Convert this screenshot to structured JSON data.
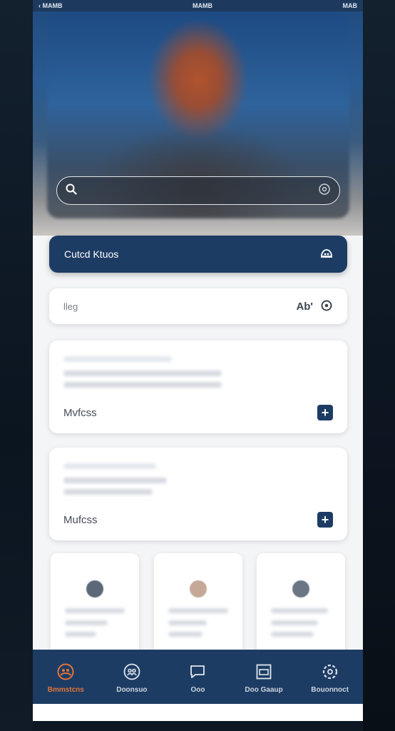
{
  "status_bar": {
    "left": "‹ MAMB",
    "center": "MAMB",
    "right": "MAB"
  },
  "search": {
    "placeholder": "",
    "value": ""
  },
  "action_button": {
    "label": "Cutcd Ktuos",
    "icon": "tools-icon"
  },
  "filter_row": {
    "label": "lleg",
    "right_label": "Ab'",
    "icon": "settings-icon"
  },
  "cards": [
    {
      "label": "Mvfcss",
      "icon": "plus-icon"
    },
    {
      "label": "Mufcss",
      "icon": "plus-icon"
    }
  ],
  "tiles": [
    {
      "dot_color": "#5b6878"
    },
    {
      "dot_color": "#c5a898"
    },
    {
      "dot_color": "#6a7686"
    }
  ],
  "bottom_nav": [
    {
      "label": "Bmmstcns",
      "icon": "home-icon",
      "active": true
    },
    {
      "label": "Doonsuo",
      "icon": "people-icon",
      "active": false
    },
    {
      "label": "Ooo",
      "icon": "chat-icon",
      "active": false
    },
    {
      "label": "Doo Gaaup",
      "icon": "gallery-icon",
      "active": false
    },
    {
      "label": "Bouonnoct",
      "icon": "settings-icon",
      "active": false
    }
  ],
  "colors": {
    "primary": "#1d3c64",
    "accent": "#e0743a",
    "background": "#f4f5f7"
  }
}
